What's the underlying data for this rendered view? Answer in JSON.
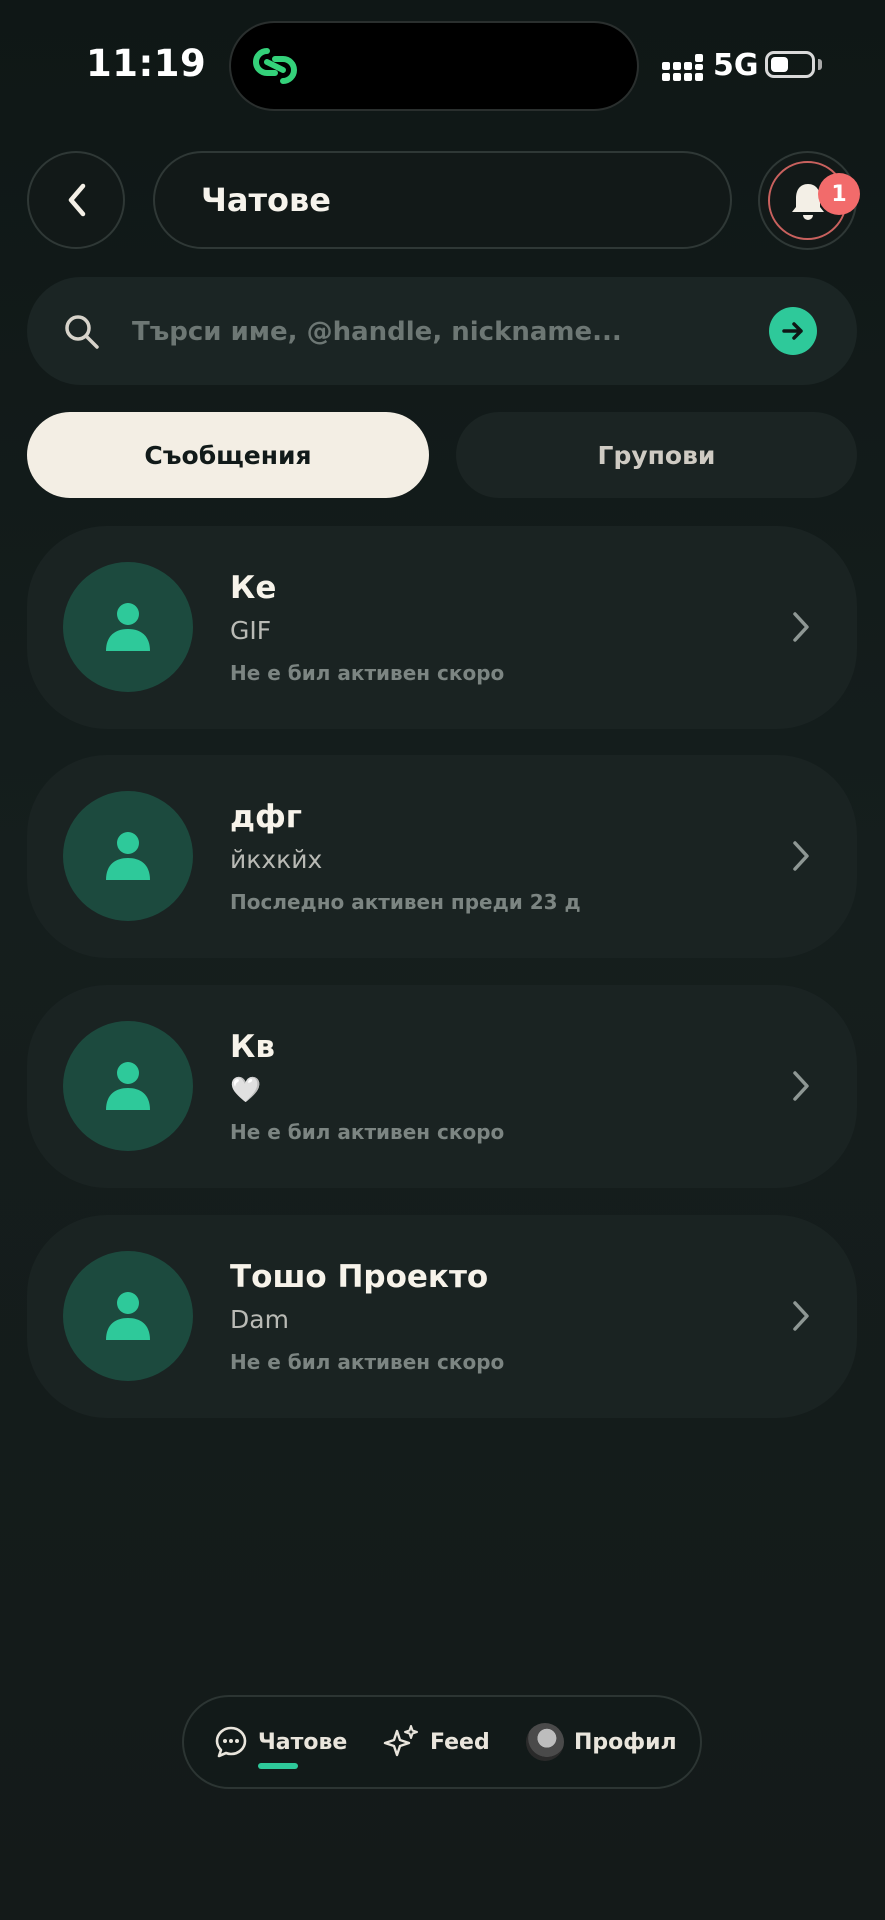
{
  "status_bar": {
    "time": "11:19",
    "network": "5G",
    "battery_level": 0.45
  },
  "header": {
    "title": "Чатове",
    "notification_count": "1"
  },
  "search": {
    "placeholder": "Търси име, @handle, nickname..."
  },
  "tabs": [
    {
      "label": "Съобщения",
      "active": true
    },
    {
      "label": "Групови",
      "active": false
    }
  ],
  "chats": [
    {
      "name": "Ке",
      "preview": "GIF",
      "status": "Не е бил активен скоро"
    },
    {
      "name": "дфг",
      "preview": "йкхкйх",
      "status": "Последно активен преди 23 д"
    },
    {
      "name": "Кв",
      "preview": "🤍",
      "status": "Не е бил активен скоро"
    },
    {
      "name": "Тошо Проекто",
      "preview": "Dam",
      "status": "Не е бил активен скоро"
    }
  ],
  "bottom_nav": [
    {
      "label": "Чатове",
      "icon": "chat-bubble-icon",
      "active": true
    },
    {
      "label": "Feed",
      "icon": "sparkles-icon",
      "active": false
    },
    {
      "label": "Профил",
      "icon": "profile-avatar",
      "active": false
    }
  ],
  "colors": {
    "accent": "#2ec99a",
    "badge": "#f26b6b",
    "background": "#131a19",
    "active_tab": "#f3eee4"
  }
}
